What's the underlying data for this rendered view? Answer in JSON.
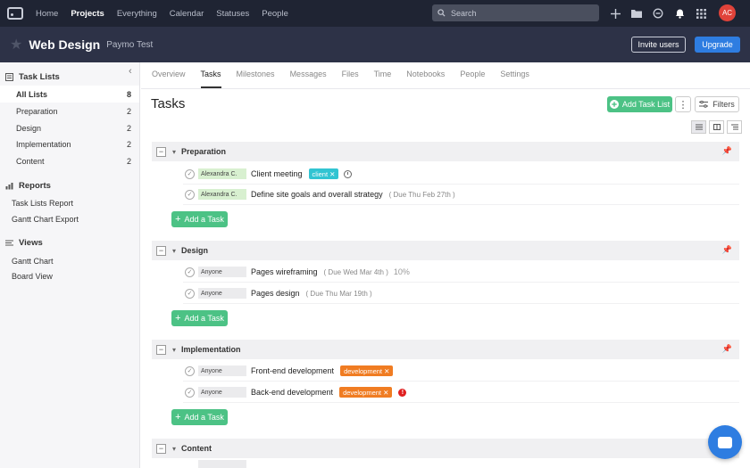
{
  "topnav": {
    "items": [
      {
        "label": "Home"
      },
      {
        "label": "Projects",
        "active": true
      },
      {
        "label": "Everything"
      },
      {
        "label": "Calendar"
      },
      {
        "label": "Statuses"
      },
      {
        "label": "People"
      }
    ],
    "search_placeholder": "Search",
    "avatar_initials": "AC"
  },
  "project": {
    "title": "Web Design",
    "subtitle": "Paymo Test",
    "invite_label": "Invite users",
    "upgrade_label": "Upgrade"
  },
  "sidebar": {
    "task_lists_label": "Task Lists",
    "lists": [
      {
        "label": "All Lists",
        "count": "8",
        "active": true
      },
      {
        "label": "Preparation",
        "count": "2"
      },
      {
        "label": "Design",
        "count": "2"
      },
      {
        "label": "Implementation",
        "count": "2"
      },
      {
        "label": "Content",
        "count": "2"
      }
    ],
    "reports_label": "Reports",
    "reports": [
      {
        "label": "Task Lists Report"
      },
      {
        "label": "Gantt Chart Export"
      }
    ],
    "views_label": "Views",
    "views": [
      {
        "label": "Gantt Chart"
      },
      {
        "label": "Board View"
      }
    ]
  },
  "tabs": [
    {
      "label": "Overview"
    },
    {
      "label": "Tasks",
      "active": true
    },
    {
      "label": "Milestones"
    },
    {
      "label": "Messages"
    },
    {
      "label": "Files"
    },
    {
      "label": "Time"
    },
    {
      "label": "Notebooks"
    },
    {
      "label": "People"
    },
    {
      "label": "Settings"
    }
  ],
  "main": {
    "title": "Tasks",
    "add_task_list_label": "Add Task List",
    "filters_label": "Filters",
    "add_task_label": "Add a Task"
  },
  "groups": [
    {
      "name": "Preparation",
      "tasks": [
        {
          "assignee": "Alexandra C.",
          "name": "Client meeting",
          "tag": "client",
          "tag_color": "#31c4d2",
          "due": "",
          "extra": "clock"
        },
        {
          "assignee": "Alexandra C.",
          "name": "Define site goals and overall strategy",
          "due": "( Due Thu Feb 27th )"
        }
      ]
    },
    {
      "name": "Design",
      "tasks": [
        {
          "assignee": "Anyone",
          "name": "Pages wireframing",
          "due": "( Due Wed Mar 4th )",
          "percent": "10%"
        },
        {
          "assignee": "Anyone",
          "name": "Pages design",
          "due": "( Due Thu Mar 19th )"
        }
      ]
    },
    {
      "name": "Implementation",
      "tasks": [
        {
          "assignee": "Anyone",
          "name": "Front-end development",
          "tag": "development",
          "tag_color": "#f07c22"
        },
        {
          "assignee": "Anyone",
          "name": "Back-end development",
          "tag": "development",
          "tag_color": "#f07c22",
          "extra": "alert"
        }
      ]
    },
    {
      "name": "Content",
      "tasks": []
    }
  ],
  "icons": {
    "pin": "pin-icon",
    "chat": "chat-icon"
  }
}
